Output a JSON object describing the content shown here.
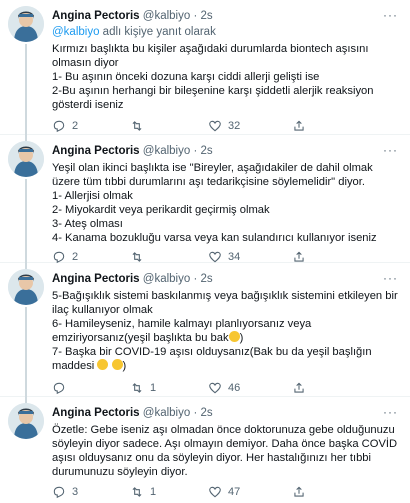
{
  "tweets": [
    {
      "author_name": "Angina Pectoris",
      "handle": "@kalbiyo",
      "time": "2s",
      "reply_to_mention": "@kalbiyo",
      "reply_to_suffix": " adlı kişiye yanıt olarak",
      "text": "Kırmızı başlıkta bu kişiler aşağıdaki durumlarda biontech aşısını olmasın diyor\n1- Bu aşının önceki dozuna karşı ciddi allerji gelişti ise\n2-Bu aşının herhangi bir bileşenine karşı şiddetli alerjik reaksiyon gösterdi iseniz",
      "replies": "2",
      "retweets": "",
      "likes": "32"
    },
    {
      "author_name": "Angina Pectoris",
      "handle": "@kalbiyo",
      "time": "2s",
      "text": "Yeşil olan ikinci başlıkta ise \"Bireyler, aşağıdakiler de dahil olmak üzere tüm tıbbi durumlarını aşı tedarikçisine söylemelidir\" diyor.\n1- Allerjisi olmak\n2- Miyokardit veya perikardit geçirmiş olmak\n3- Ateş olması\n4- Kanama bozukluğu varsa veya kan sulandırıcı kullanıyor iseniz",
      "replies": "2",
      "retweets": "",
      "likes": "34"
    },
    {
      "author_name": "Angina Pectoris",
      "handle": "@kalbiyo",
      "time": "2s",
      "text_parts": [
        "5-Bağışıklık sistemi baskılanmış veya bağışıklık sistemini etkileyen bir ilaç kullanıyor olmak\n6- Hamileyseniz, hamile kalmayı planlıyorsanız veya emziriyorsanız(yeşil başlıkta bu bak",
        ")\n7- Başka bir COVID-19 aşısı olduysanız(Bak bu da yeşil başlığın maddesi ",
        " ",
        ")"
      ],
      "replies": "",
      "retweets": "1",
      "likes": "46"
    },
    {
      "author_name": "Angina Pectoris",
      "handle": "@kalbiyo",
      "time": "2s",
      "text": "Özetle: Gebe iseniz aşı olmadan önce doktorunuza gebe olduğunuzu söyleyin diyor sadece. Aşı olmayın demiyor. Daha önce başka COVİD aşısı olduysanız onu da söyleyin diyor. Her hastalığınızı her tıbbi durumunuzu söyleyin diyor.",
      "replies": "3",
      "retweets": "1",
      "likes": "47"
    }
  ],
  "icons": {
    "reply": "reply-icon",
    "retweet": "retweet-icon",
    "like": "heart-icon",
    "share": "share-icon",
    "more": "more-icon"
  },
  "colors": {
    "accent": "#1d9bf0",
    "muted": "#536471",
    "divider": "#eff3f4",
    "thread_line": "#cfd9de"
  }
}
